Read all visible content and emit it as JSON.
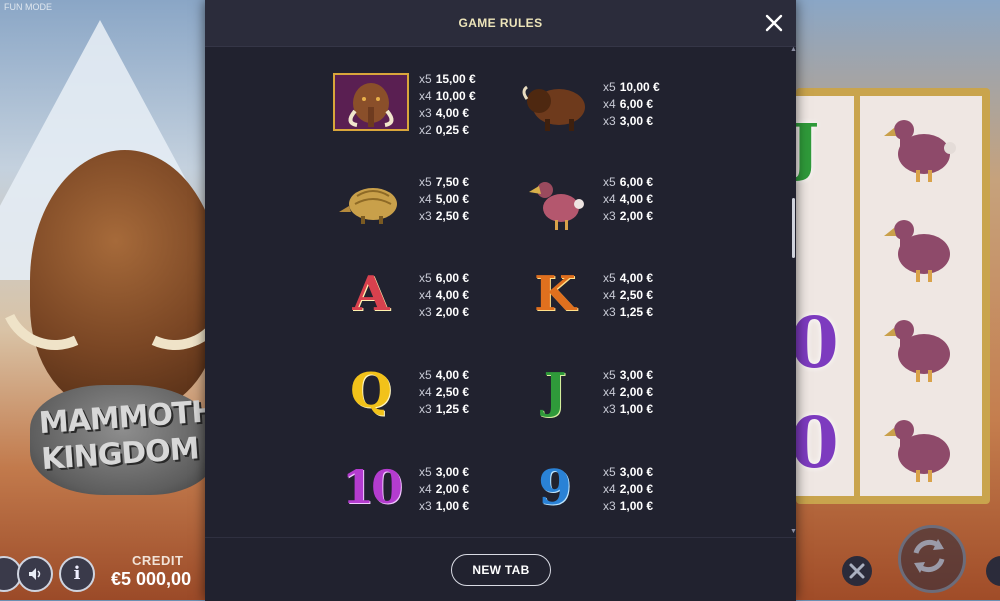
{
  "app": {
    "fun_mode": "FUN MODE",
    "logo_line1": "MAMMOTH",
    "logo_line2": "KINGDOM"
  },
  "hud": {
    "credit_label": "CREDIT",
    "credit_value": "€5 000,00",
    "info_icon": "i"
  },
  "modal": {
    "title": "GAME RULES",
    "new_tab_label": "NEW TAB"
  },
  "symbols": [
    {
      "icon": "mammoth-icon",
      "pays": [
        {
          "mult": "x5",
          "value": "15,00 €"
        },
        {
          "mult": "x4",
          "value": "10,00 €"
        },
        {
          "mult": "x3",
          "value": "4,00 €"
        },
        {
          "mult": "x2",
          "value": "0,25 €"
        }
      ]
    },
    {
      "icon": "bison-icon",
      "pays": [
        {
          "mult": "x5",
          "value": "10,00 €"
        },
        {
          "mult": "x4",
          "value": "6,00 €"
        },
        {
          "mult": "x3",
          "value": "3,00 €"
        }
      ]
    },
    {
      "icon": "armadillo-icon",
      "pays": [
        {
          "mult": "x5",
          "value": "7,50 €"
        },
        {
          "mult": "x4",
          "value": "5,00 €"
        },
        {
          "mult": "x3",
          "value": "2,50 €"
        }
      ]
    },
    {
      "icon": "dodo-icon",
      "pays": [
        {
          "mult": "x5",
          "value": "6,00 €"
        },
        {
          "mult": "x4",
          "value": "4,00 €"
        },
        {
          "mult": "x3",
          "value": "2,00 €"
        }
      ]
    },
    {
      "icon": "letter-a-icon",
      "glyph": "A",
      "pays": [
        {
          "mult": "x5",
          "value": "6,00 €"
        },
        {
          "mult": "x4",
          "value": "4,00 €"
        },
        {
          "mult": "x3",
          "value": "2,00 €"
        }
      ]
    },
    {
      "icon": "letter-k-icon",
      "glyph": "K",
      "pays": [
        {
          "mult": "x5",
          "value": "4,00 €"
        },
        {
          "mult": "x4",
          "value": "2,50 €"
        },
        {
          "mult": "x3",
          "value": "1,25 €"
        }
      ]
    },
    {
      "icon": "letter-q-icon",
      "glyph": "Q",
      "pays": [
        {
          "mult": "x5",
          "value": "4,00 €"
        },
        {
          "mult": "x4",
          "value": "2,50 €"
        },
        {
          "mult": "x3",
          "value": "1,25 €"
        }
      ]
    },
    {
      "icon": "letter-j-icon",
      "glyph": "J",
      "pays": [
        {
          "mult": "x5",
          "value": "3,00 €"
        },
        {
          "mult": "x4",
          "value": "2,00 €"
        },
        {
          "mult": "x3",
          "value": "1,00 €"
        }
      ]
    },
    {
      "icon": "number-10-icon",
      "glyph": "10",
      "pays": [
        {
          "mult": "x5",
          "value": "3,00 €"
        },
        {
          "mult": "x4",
          "value": "2,00 €"
        },
        {
          "mult": "x3",
          "value": "1,00 €"
        }
      ]
    },
    {
      "icon": "number-9-icon",
      "glyph": "9",
      "pays": [
        {
          "mult": "x5",
          "value": "3,00 €"
        },
        {
          "mult": "x4",
          "value": "2,00 €"
        },
        {
          "mult": "x3",
          "value": "1,00 €"
        }
      ]
    }
  ]
}
